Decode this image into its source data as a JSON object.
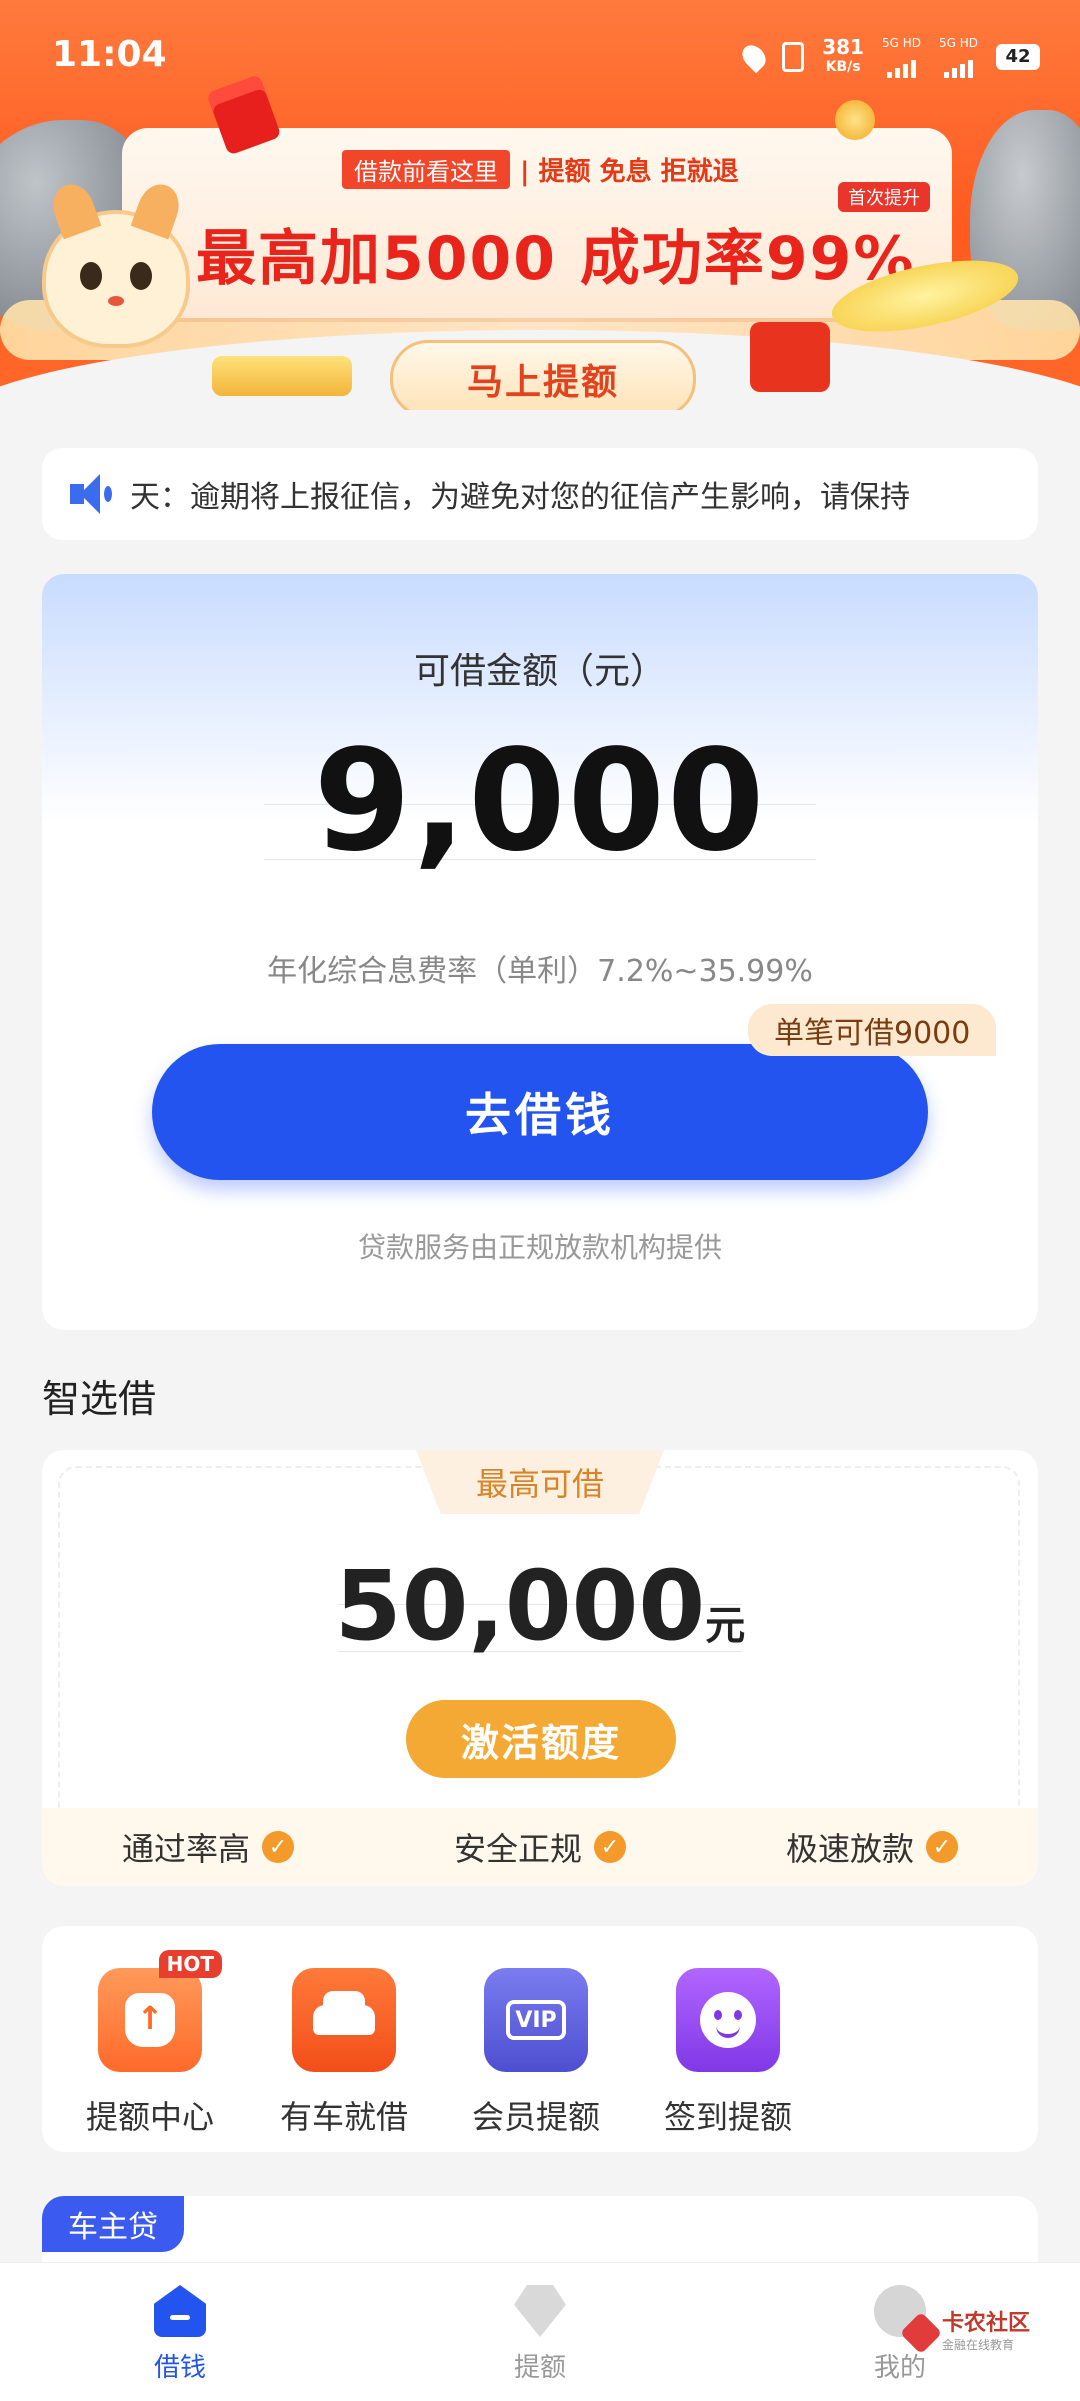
{
  "status_bar": {
    "time": "11:04",
    "speed_value": "381",
    "speed_unit": "KB/s",
    "signal1_label": "5G HD",
    "signal2_label": "5G HD",
    "battery": "42"
  },
  "banner": {
    "tag": "借款前看这里",
    "tag_suffix": "| 提额 免息 拒就退",
    "first_badge": "首次提升",
    "headline": "最高加5000 成功率99%",
    "cta": "马上提额"
  },
  "notice": {
    "text": "天：逾期将上报征信，为避免对您的征信产生影响，请保持"
  },
  "borrow": {
    "label": "可借金额（元）",
    "amount": "9,000",
    "rate": "年化综合息费率（单利）7.2%~35.99%",
    "single_tag": "单笔可借9000",
    "button": "去借钱",
    "service": "贷款服务由正规放款机构提供"
  },
  "smart": {
    "section_title": "智选借",
    "max_label": "最高可借",
    "amount": "50,000",
    "unit": "元",
    "activate": "激活额度",
    "features": [
      "通过率高",
      "安全正规",
      "极速放款"
    ]
  },
  "quick_actions": [
    {
      "label": "提额中心",
      "badge": "HOT",
      "icon": "money-bag-icon"
    },
    {
      "label": "有车就借",
      "icon": "car-icon"
    },
    {
      "label": "会员提额",
      "icon": "vip-icon"
    },
    {
      "label": "签到提额",
      "icon": "smile-icon"
    }
  ],
  "car_loan": {
    "tag": "车主贷"
  },
  "nav": [
    {
      "label": "借钱",
      "active": true,
      "icon": "home-icon"
    },
    {
      "label": "提额",
      "active": false,
      "icon": "diamond-icon"
    },
    {
      "label": "我的",
      "active": false,
      "icon": "profile-icon"
    }
  ],
  "watermark": {
    "title": "卡农社区",
    "subtitle": "金融在线教育"
  },
  "colors": {
    "primary": "#2454f0",
    "banner_orange": "#ff5a1f",
    "accent_orange": "#f3a933"
  }
}
